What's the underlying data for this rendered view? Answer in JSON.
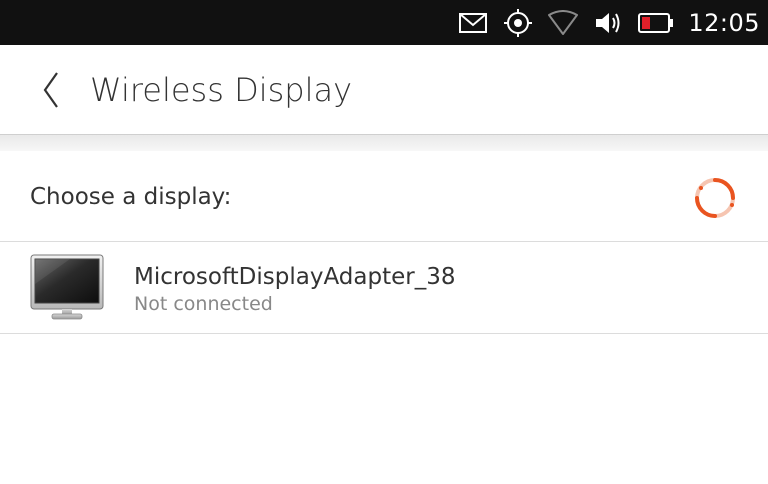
{
  "status_bar": {
    "icons": [
      "mail-icon",
      "location-icon",
      "wifi-icon",
      "volume-icon",
      "battery-icon"
    ],
    "time": "12:05",
    "battery_color": "#e0202a"
  },
  "header": {
    "back_icon": "chevron-left-icon",
    "title": "Wireless Display"
  },
  "section": {
    "label": "Choose a display:",
    "spinner_icon": "activity-spinner-icon",
    "spinner_color": "#e95420"
  },
  "devices": [
    {
      "icon": "monitor-icon",
      "name": "MicrosoftDisplayAdapter_38",
      "status": "Not connected"
    }
  ]
}
